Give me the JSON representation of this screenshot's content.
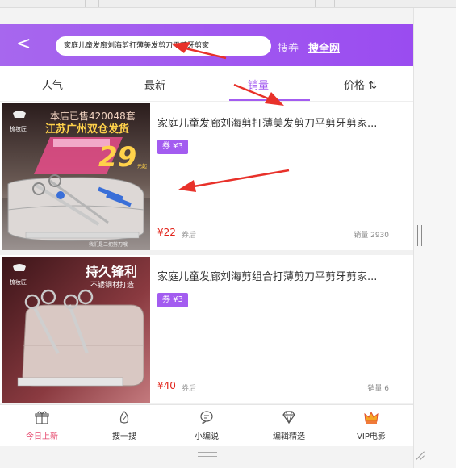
{
  "header": {
    "search_value": "家庭儿童发廊刘海剪打薄美发剪刀平剪牙剪家",
    "coupon_search_label": "搜券",
    "all_web_label": "搜全网"
  },
  "tabs": [
    {
      "label": "人气"
    },
    {
      "label": "最新"
    },
    {
      "label": "销量"
    },
    {
      "label": "价格 ⇅"
    }
  ],
  "products": [
    {
      "title": "家庭儿童发廊刘海剪打薄美发剪刀平剪牙剪家...",
      "coupon": "券 ¥3",
      "price": "¥22",
      "price_note": "券后",
      "sales": "销量 2930",
      "image": {
        "brand": "梳妆匠",
        "line1": "本店已售420048套",
        "line2": "江苏广州双仓发货",
        "big_number": "29",
        "unit": "元起",
        "caption": "我们是二把剪刀哦"
      }
    },
    {
      "title": "家庭儿童发廊刘海剪组合打薄剪刀平剪牙剪家...",
      "coupon": "券 ¥3",
      "price": "¥40",
      "price_note": "券后",
      "sales": "销量 6",
      "image": {
        "brand": "梳妆匠",
        "line1": "持久锋利",
        "line2": "不锈钢材打造"
      }
    }
  ],
  "bottom_nav": [
    {
      "label": "今日上新",
      "icon": "gift-icon"
    },
    {
      "label": "搜一搜",
      "icon": "search-leaf-icon"
    },
    {
      "label": "小编说",
      "icon": "chat-bubble-icon"
    },
    {
      "label": "编辑精选",
      "icon": "diamond-icon"
    },
    {
      "label": "VIP电影",
      "icon": "crown-icon"
    }
  ],
  "colors": {
    "accent": "#a35cf0",
    "price": "#e2231a",
    "active_nav": "#e5456a",
    "annotation_arrow": "#e8312a"
  }
}
